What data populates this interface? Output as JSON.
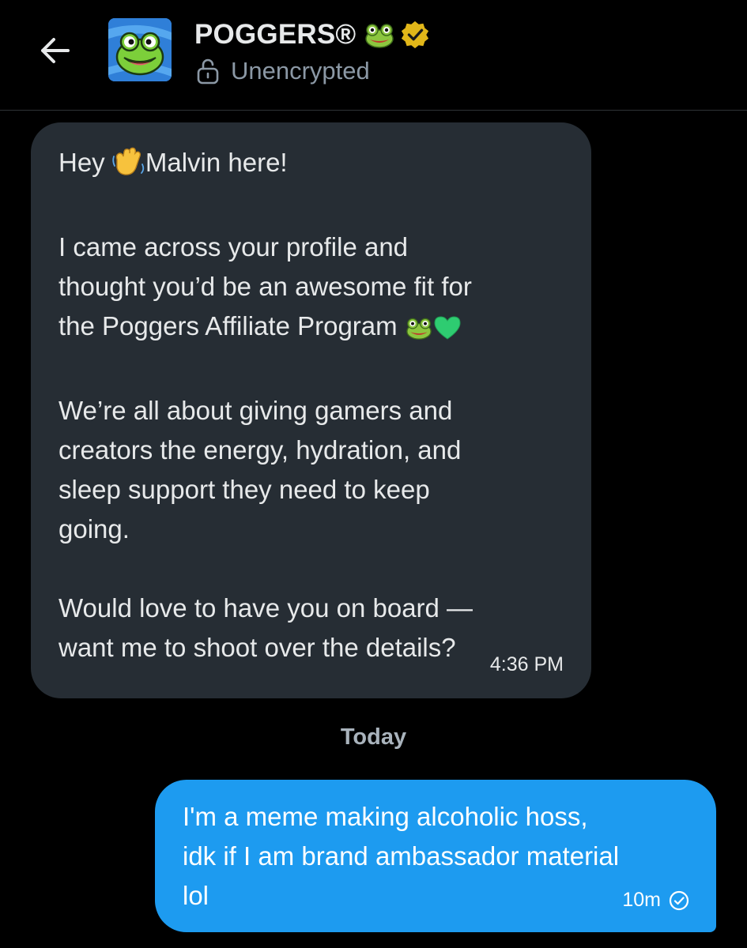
{
  "header": {
    "title": "POGGERS®",
    "title_emoji": "frog-face-icon",
    "verified_badge": "verified-badge-icon",
    "subtitle": "Unencrypted",
    "back_icon": "arrow-left-icon",
    "avatar": "frog-avatar"
  },
  "messages": {
    "incoming": {
      "greeting_before": "Hey ",
      "greeting_after": "Malvin here!",
      "para2_line1": "I came across your profile and",
      "para2_line2": "thought you’d be an awesome fit for",
      "para2_line3": "the Poggers Affiliate Program ",
      "para3_line1": "We’re all about giving gamers and",
      "para3_line2": "creators the energy, hydration, and",
      "para3_line3": "sleep support they need to keep",
      "para3_line4": "going.",
      "para4_line1": "Would love to have you on board —",
      "para4_line2": "want me to shoot over the details?",
      "timestamp": "4:36 PM"
    },
    "date_separator": "Today",
    "outgoing": {
      "line1": "I'm a meme making alcoholic hoss,",
      "line2": "idk if I am brand ambassador material",
      "line3": "lol",
      "timestamp": "10m",
      "status_icon": "check-circle-icon"
    }
  },
  "colors": {
    "background": "#000000",
    "incoming_bubble": "#262d34",
    "outgoing_bubble": "#1d9bf0",
    "text_primary": "#e7e9ea",
    "text_secondary": "#8b98a5",
    "verified_gold": "#e2b719"
  }
}
